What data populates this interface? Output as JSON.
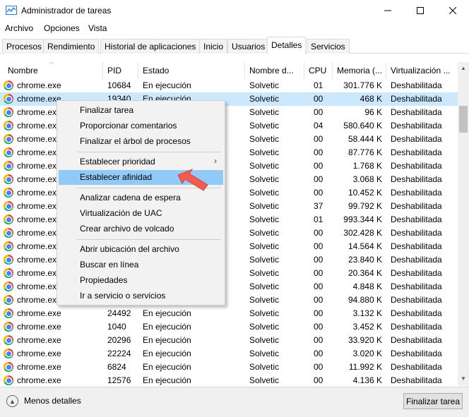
{
  "window": {
    "title": "Administrador de tareas"
  },
  "menu": [
    "Archivo",
    "Opciones",
    "Vista"
  ],
  "tabs": [
    {
      "label": "Procesos",
      "active": false
    },
    {
      "label": "Rendimiento",
      "active": false
    },
    {
      "label": "Historial de aplicaciones",
      "active": false
    },
    {
      "label": "Inicio",
      "active": false
    },
    {
      "label": "Usuarios",
      "active": false
    },
    {
      "label": "Detalles",
      "active": true
    },
    {
      "label": "Servicios",
      "active": false
    }
  ],
  "columns": [
    "Nombre",
    "PID",
    "Estado",
    "Nombre d...",
    "CPU",
    "Memoria (...",
    "Virtualización ..."
  ],
  "rows": [
    {
      "name": "chrome.exe",
      "pid": "10684",
      "status": "En ejecución",
      "user": "Solvetic",
      "cpu": "01",
      "mem": "301.776 K",
      "virt": "Deshabilitada"
    },
    {
      "name": "chrome.exe",
      "pid": "19340",
      "status": "En ejecución",
      "user": "Solvetic",
      "cpu": "00",
      "mem": "468 K",
      "virt": "Deshabilitada"
    },
    {
      "name": "chrome.exe",
      "pid": "",
      "status": "",
      "user": "Solvetic",
      "cpu": "00",
      "mem": "96 K",
      "virt": "Deshabilitada"
    },
    {
      "name": "chrome.exe",
      "pid": "",
      "status": "",
      "user": "Solvetic",
      "cpu": "04",
      "mem": "580.640 K",
      "virt": "Deshabilitada"
    },
    {
      "name": "chrome.exe",
      "pid": "",
      "status": "",
      "user": "Solvetic",
      "cpu": "00",
      "mem": "58.444 K",
      "virt": "Deshabilitada"
    },
    {
      "name": "chrome.exe",
      "pid": "",
      "status": "",
      "user": "Solvetic",
      "cpu": "00",
      "mem": "87.776 K",
      "virt": "Deshabilitada"
    },
    {
      "name": "chrome.exe",
      "pid": "",
      "status": "",
      "user": "Solvetic",
      "cpu": "00",
      "mem": "1.768 K",
      "virt": "Deshabilitada"
    },
    {
      "name": "chrome.exe",
      "pid": "",
      "status": "",
      "user": "Solvetic",
      "cpu": "00",
      "mem": "3.068 K",
      "virt": "Deshabilitada"
    },
    {
      "name": "chrome.exe",
      "pid": "",
      "status": "",
      "user": "Solvetic",
      "cpu": "00",
      "mem": "10.452 K",
      "virt": "Deshabilitada"
    },
    {
      "name": "chrome.exe",
      "pid": "",
      "status": "",
      "user": "Solvetic",
      "cpu": "37",
      "mem": "99.792 K",
      "virt": "Deshabilitada"
    },
    {
      "name": "chrome.exe",
      "pid": "",
      "status": "",
      "user": "Solvetic",
      "cpu": "01",
      "mem": "993.344 K",
      "virt": "Deshabilitada"
    },
    {
      "name": "chrome.exe",
      "pid": "",
      "status": "",
      "user": "Solvetic",
      "cpu": "00",
      "mem": "302.428 K",
      "virt": "Deshabilitada"
    },
    {
      "name": "chrome.exe",
      "pid": "",
      "status": "",
      "user": "Solvetic",
      "cpu": "00",
      "mem": "14.564 K",
      "virt": "Deshabilitada"
    },
    {
      "name": "chrome.exe",
      "pid": "",
      "status": "",
      "user": "Solvetic",
      "cpu": "00",
      "mem": "23.840 K",
      "virt": "Deshabilitada"
    },
    {
      "name": "chrome.exe",
      "pid": "",
      "status": "",
      "user": "Solvetic",
      "cpu": "00",
      "mem": "20.364 K",
      "virt": "Deshabilitada"
    },
    {
      "name": "chrome.exe",
      "pid": "",
      "status": "",
      "user": "Solvetic",
      "cpu": "00",
      "mem": "4.848 K",
      "virt": "Deshabilitada"
    },
    {
      "name": "chrome.exe",
      "pid": "",
      "status": "",
      "user": "Solvetic",
      "cpu": "00",
      "mem": "94.880 K",
      "virt": "Deshabilitada"
    },
    {
      "name": "chrome.exe",
      "pid": "24492",
      "status": "En ejecución",
      "user": "Solvetic",
      "cpu": "00",
      "mem": "3.132 K",
      "virt": "Deshabilitada"
    },
    {
      "name": "chrome.exe",
      "pid": "1040",
      "status": "En ejecución",
      "user": "Solvetic",
      "cpu": "00",
      "mem": "3.452 K",
      "virt": "Deshabilitada"
    },
    {
      "name": "chrome.exe",
      "pid": "20296",
      "status": "En ejecución",
      "user": "Solvetic",
      "cpu": "00",
      "mem": "33.920 K",
      "virt": "Deshabilitada"
    },
    {
      "name": "chrome.exe",
      "pid": "22224",
      "status": "En ejecución",
      "user": "Solvetic",
      "cpu": "00",
      "mem": "3.020 K",
      "virt": "Deshabilitada"
    },
    {
      "name": "chrome.exe",
      "pid": "6824",
      "status": "En ejecución",
      "user": "Solvetic",
      "cpu": "00",
      "mem": "11.992 K",
      "virt": "Deshabilitada"
    },
    {
      "name": "chrome.exe",
      "pid": "12576",
      "status": "En ejecución",
      "user": "Solvetic",
      "cpu": "00",
      "mem": "4.136 K",
      "virt": "Deshabilitada"
    }
  ],
  "selected_row": 1,
  "context_menu": {
    "items": [
      {
        "label": "Finalizar tarea",
        "submenu": false,
        "separator_after": false
      },
      {
        "label": "Proporcionar comentarios",
        "submenu": false,
        "separator_after": false
      },
      {
        "label": "Finalizar el árbol de procesos",
        "submenu": false,
        "separator_after": true
      },
      {
        "label": "Establecer prioridad",
        "submenu": true,
        "separator_after": false
      },
      {
        "label": "Establecer afinidad",
        "submenu": false,
        "separator_after": true,
        "highlighted": true
      },
      {
        "label": "Analizar cadena de espera",
        "submenu": false,
        "separator_after": false
      },
      {
        "label": "Virtualización de UAC",
        "submenu": false,
        "separator_after": false
      },
      {
        "label": "Crear archivo de volcado",
        "submenu": false,
        "separator_after": true
      },
      {
        "label": "Abrir ubicación del archivo",
        "submenu": false,
        "separator_after": false
      },
      {
        "label": "Buscar en línea",
        "submenu": false,
        "separator_after": false
      },
      {
        "label": "Propiedades",
        "submenu": false,
        "separator_after": false
      },
      {
        "label": "Ir a servicio o servicios",
        "submenu": false,
        "separator_after": false
      }
    ]
  },
  "footer": {
    "fewer_details": "Menos detalles",
    "end_task": "Finalizar tarea"
  },
  "colors": {
    "selected_row": "#cce8ff",
    "menu_highlight": "#91c9f7",
    "annotation_arrow": "#f25b50"
  }
}
